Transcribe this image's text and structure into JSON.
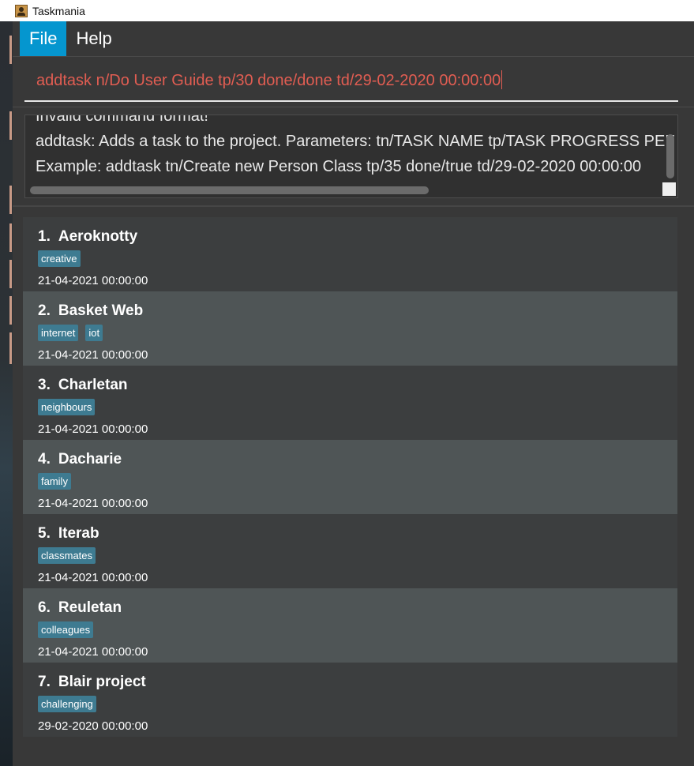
{
  "window": {
    "title": "Taskmania"
  },
  "menu": {
    "items": [
      "File",
      "Help"
    ]
  },
  "command": {
    "value": "addtask n/Do User Guide tp/30 done/done td/29-02-2020 00:00:00"
  },
  "result": {
    "lines": [
      "Invalid command format!",
      "addtask: Adds a task to the project. Parameters: tn/TASK NAME tp/TASK PROGRESS PEF",
      "Example: addtask tn/Create new Person Class tp/35 done/true td/29-02-2020 00:00:00"
    ]
  },
  "tasks": [
    {
      "index": "1.",
      "name": "Aeroknotty",
      "tags": [
        "creative"
      ],
      "date": "21-04-2021 00:00:00"
    },
    {
      "index": "2.",
      "name": "Basket Web",
      "tags": [
        "internet",
        "iot"
      ],
      "date": "21-04-2021 00:00:00"
    },
    {
      "index": "3.",
      "name": "Charletan",
      "tags": [
        "neighbours"
      ],
      "date": "21-04-2021 00:00:00"
    },
    {
      "index": "4.",
      "name": "Dacharie",
      "tags": [
        "family"
      ],
      "date": "21-04-2021 00:00:00"
    },
    {
      "index": "5.",
      "name": "Iterab",
      "tags": [
        "classmates"
      ],
      "date": "21-04-2021 00:00:00"
    },
    {
      "index": "6.",
      "name": "Reuletan",
      "tags": [
        "colleagues"
      ],
      "date": "21-04-2021 00:00:00"
    },
    {
      "index": "7.",
      "name": "Blair project",
      "tags": [
        "challenging"
      ],
      "date": "29-02-2020 00:00:00"
    }
  ],
  "colors": {
    "accent": "#0596cf",
    "error_text": "#e15d52",
    "tag_bg": "#3e7b91"
  }
}
